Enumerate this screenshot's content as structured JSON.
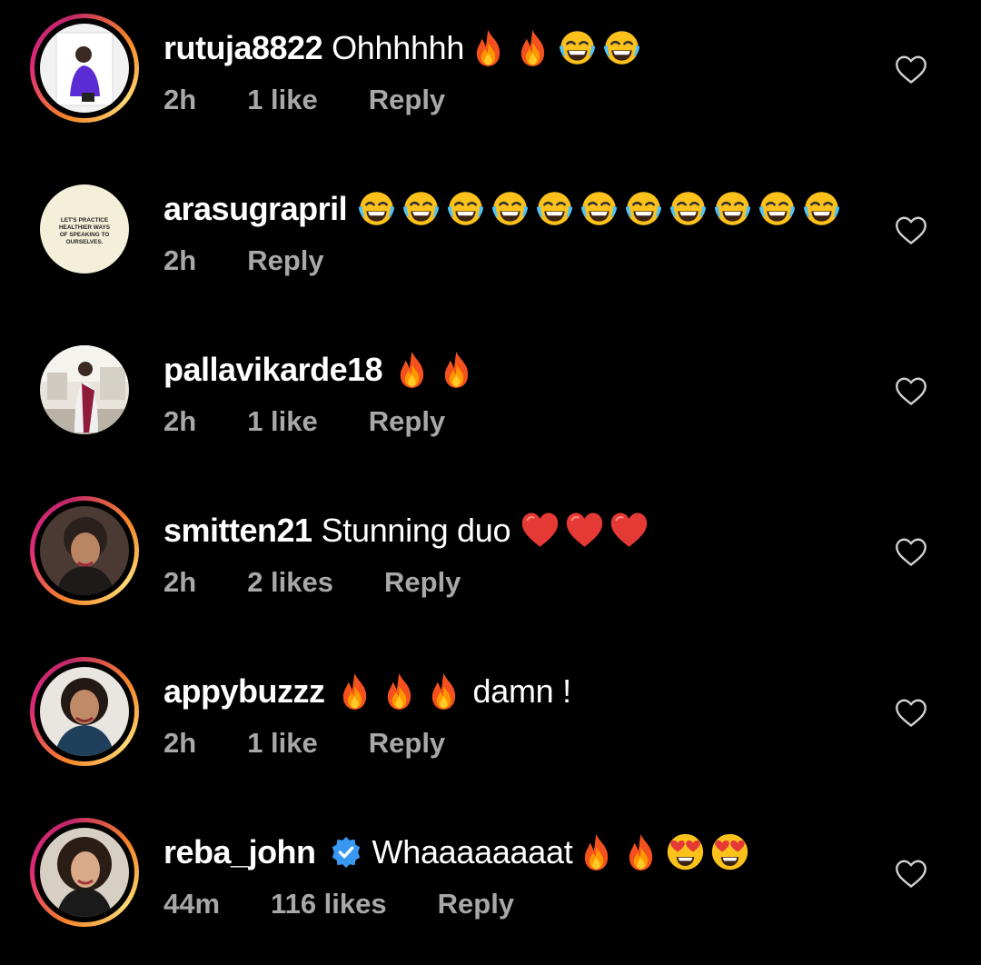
{
  "comments": [
    {
      "username": "rutuja8822",
      "text_before": "Ohhhhhh",
      "emojis": [
        "fire",
        "fire",
        "joy",
        "joy"
      ],
      "text_after": "",
      "time": "2h",
      "likes": "1 like",
      "reply": "Reply",
      "story_ring": true,
      "avatar_icon": "avatar-photo-woman-purple-top"
    },
    {
      "username": "arasugrapril",
      "text_before": "",
      "emojis": [
        "joy",
        "joy",
        "joy",
        "joy",
        "joy",
        "joy",
        "joy",
        "joy",
        "joy",
        "joy",
        "joy"
      ],
      "text_after": "",
      "time": "2h",
      "likes": "",
      "reply": "Reply",
      "story_ring": false,
      "avatar_text": [
        "LET'S PRACTICE",
        "HEALTHIER WAYS",
        "OF SPEAKING TO",
        "OURSELVES."
      ]
    },
    {
      "username": "pallavikarde18",
      "text_before": "",
      "emojis": [
        "fire",
        "fire"
      ],
      "text_after": "",
      "time": "2h",
      "likes": "1 like",
      "reply": "Reply",
      "story_ring": false,
      "avatar_icon": "avatar-photo-woman-saree"
    },
    {
      "username": "smitten21",
      "text_before": "Stunning duo",
      "emojis": [
        "red-heart",
        "red-heart",
        "red-heart"
      ],
      "text_after": "",
      "time": "2h",
      "likes": "2 likes",
      "reply": "Reply",
      "story_ring": true,
      "avatar_icon": "avatar-photo-woman-portrait"
    },
    {
      "username": "appybuzzz",
      "text_before": "",
      "emojis": [
        "fire",
        "fire",
        "fire"
      ],
      "text_after": "damn !",
      "time": "2h",
      "likes": "1 like",
      "reply": "Reply",
      "story_ring": true,
      "avatar_icon": "avatar-photo-woman-smiling"
    },
    {
      "username": "reba_john",
      "verified": true,
      "text_before": "Whaaaaaaaat",
      "emojis": [
        "fire",
        "fire",
        "heart-eyes",
        "heart-eyes"
      ],
      "text_after": "",
      "time": "44m",
      "likes": "116 likes",
      "reply": "Reply",
      "story_ring": true,
      "avatar_icon": "avatar-photo-woman-curly-hair"
    }
  ],
  "colors": {
    "background": "#000000",
    "text": "#ffffff",
    "meta": "#a8a8a8",
    "verified_badge": "#3897f0"
  }
}
